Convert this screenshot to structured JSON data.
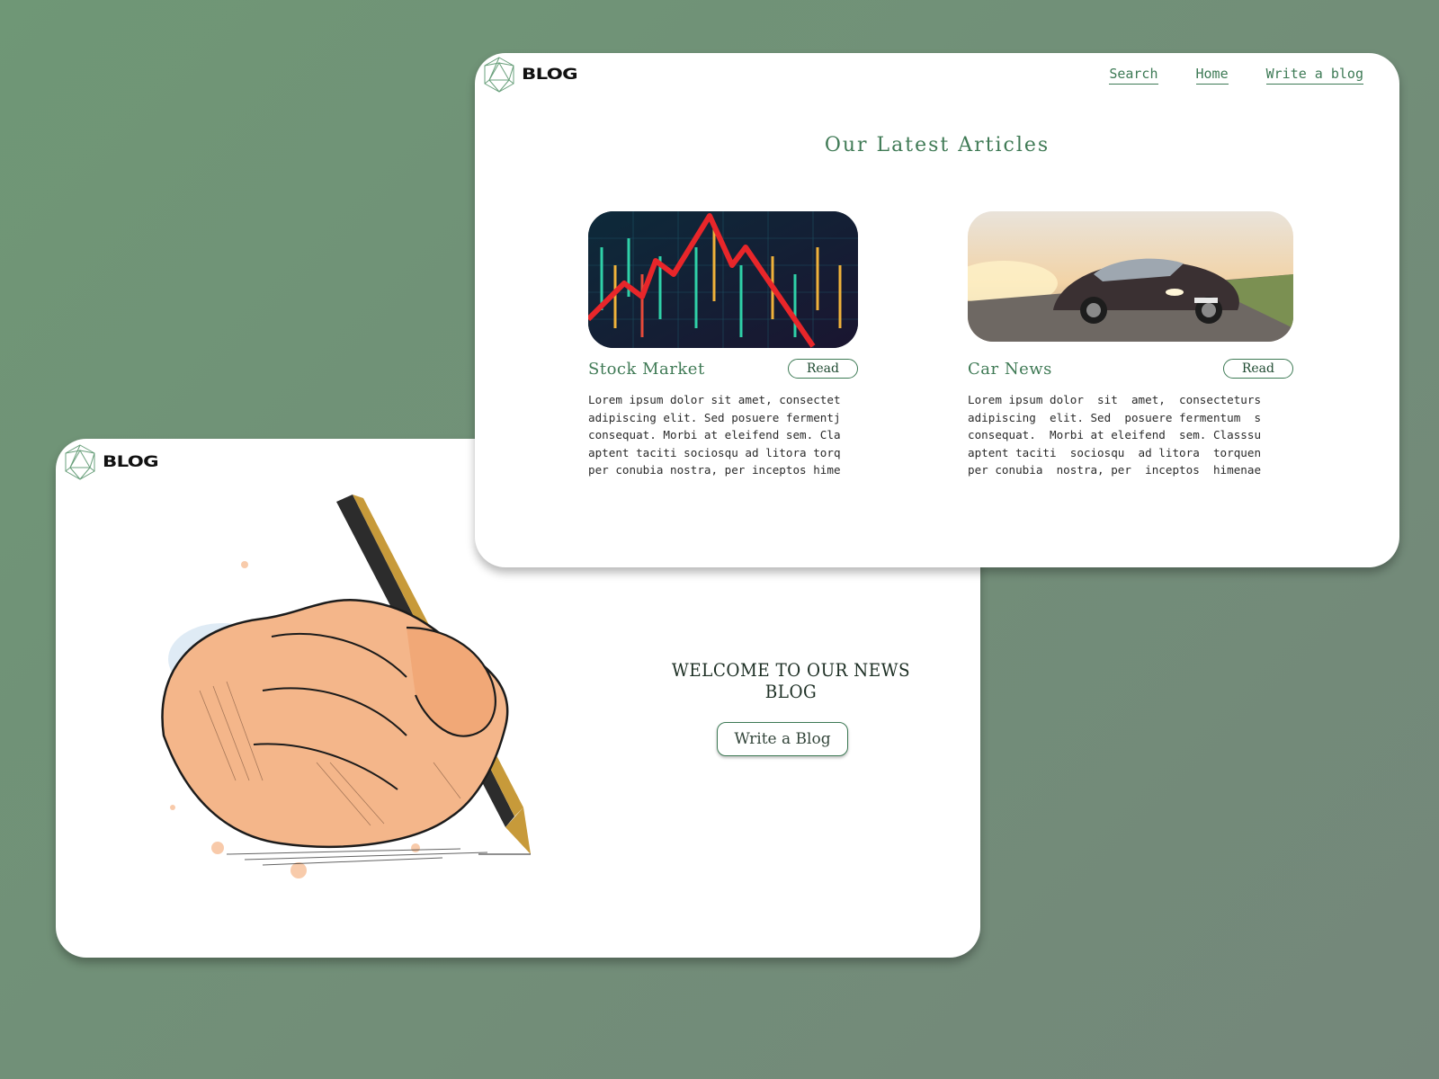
{
  "brand": {
    "logo_text": "BLOG",
    "accent": "#3d7a55"
  },
  "landing": {
    "welcome": "WELCOME TO OUR NEWS BLOG",
    "cta_label": "Write a Blog",
    "hero_illustration": "hand-writing-with-pen"
  },
  "articles_page": {
    "nav": [
      "Search",
      "Home",
      "Write a blog"
    ],
    "title": "Our Latest Articles",
    "articles": [
      {
        "title": "Stock Market",
        "read_label": "Read",
        "image": "stock-market-chart",
        "lines": [
          "Lorem ipsum dolor sit amet, consectet",
          "adipiscing elit. Sed posuere fermentj",
          "consequat. Morbi at eleifend sem. Cla",
          "aptent taciti sociosqu ad litora torq",
          "per conubia nostra, per inceptos hime"
        ]
      },
      {
        "title": "Car News",
        "read_label": "Read",
        "image": "sports-car-on-road",
        "lines": [
          "Lorem ipsum dolor  sit  amet,  consecteturs",
          "adipiscing  elit. Sed  posuere fermentum  s",
          "consequat.  Morbi at eleifend  sem. Classsu",
          "aptent taciti  sociosqu  ad litora  torquen",
          "per conubia  nostra, per  inceptos  himenae"
        ]
      }
    ]
  }
}
